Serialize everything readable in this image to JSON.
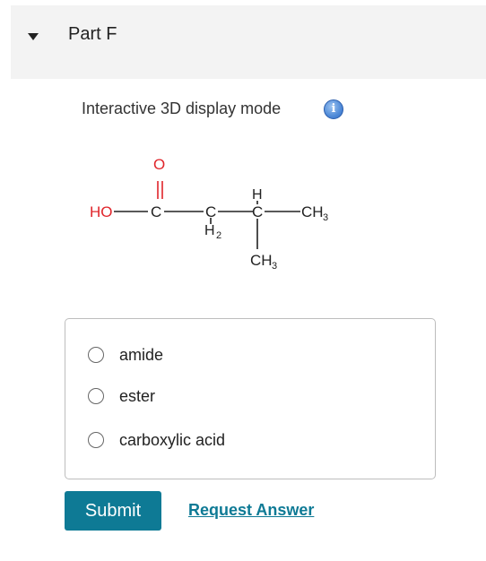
{
  "header": {
    "title": "Part F",
    "collapse_icon": "caret-down-icon"
  },
  "display_mode": {
    "label": "Interactive 3D display mode",
    "info_icon": "info-icon",
    "info_glyph": "i"
  },
  "molecule": {
    "hydroxyl": "HO",
    "carbonyl_oxygen": "O",
    "carbon": "C",
    "h2": "H",
    "h2_sub": "2",
    "h": "H",
    "ch3_right": "CH",
    "ch3_right_sub": "3",
    "ch3_bottom": "CH",
    "ch3_bottom_sub": "3",
    "colors": {
      "oxygen": "#e0252b",
      "carbon": "#222222"
    }
  },
  "options": [
    {
      "label": "amide",
      "selected": false
    },
    {
      "label": "ester",
      "selected": false
    },
    {
      "label": "carboxylic acid",
      "selected": false
    }
  ],
  "actions": {
    "submit_label": "Submit",
    "request_label": "Request Answer"
  },
  "colors": {
    "accent": "#0e7a95",
    "header_bg": "#f3f3f3"
  }
}
